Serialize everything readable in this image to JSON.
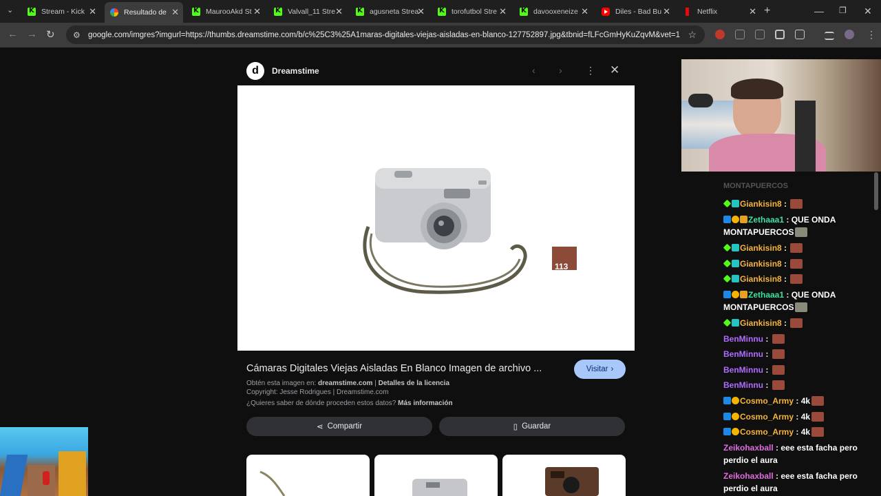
{
  "tabs": [
    {
      "title": "Stream - Kick",
      "favicon": "kick-icon",
      "active": false
    },
    {
      "title": "Resultado de",
      "favicon": "google-icon",
      "active": true
    },
    {
      "title": "MaurooAkd St",
      "favicon": "kick-icon",
      "active": false
    },
    {
      "title": "Valvall_11 Stre",
      "favicon": "kick-icon",
      "active": false
    },
    {
      "title": "agusneta Strea",
      "favicon": "kick-icon",
      "active": false
    },
    {
      "title": "torofutbol Stre",
      "favicon": "kick-icon",
      "active": false
    },
    {
      "title": "davooxeneize",
      "favicon": "kick-icon",
      "active": false
    },
    {
      "title": "Diles - Bad Bu",
      "favicon": "youtube-icon",
      "active": false
    },
    {
      "title": "Netflix",
      "favicon": "netflix-icon",
      "active": false
    }
  ],
  "toolbar": {
    "url": "google.com/imgres?imgurl=https://thumbs.dreamstime.com/b/c%25C3%25A1maras-digitales-viejas-aisladas-en-blanco-127752897.jpg&tbnid=fLFcGmHyKuZqvM&vet=1&i..."
  },
  "viewer": {
    "source_logo": "d",
    "source_name": "Dreamstime",
    "title": "Cámaras Digitales Viejas Aisladas En Blanco Imagen de archivo ...",
    "visit_label": "Visitar",
    "obtain_prefix": "Obtén esta imagen en:",
    "obtain_site": "dreamstime.com",
    "license_sep": "|",
    "license_label": "Detalles de la licencia",
    "copyright": "Copyright: Jesse Rodrigues | Dreamstime.com",
    "origin_question": "¿Quieres saber de dónde proceden estos datos?",
    "more_info": "Más información",
    "share_label": "Compartir",
    "save_label": "Guardar",
    "overlay_number": "113"
  },
  "chat": [
    {
      "user": "Giankisin8",
      "color": "orange",
      "badges": [
        "green",
        "teal"
      ],
      "text": "",
      "emote": true
    },
    {
      "user": "Zethaaa1",
      "color": "teal",
      "badges": [
        "blue",
        "gold",
        "orange"
      ],
      "text": "QUE ONDA MONTAPUERCOS",
      "emote": true
    },
    {
      "user": "Giankisin8",
      "color": "orange",
      "badges": [
        "green",
        "teal"
      ],
      "text": "",
      "emote": true
    },
    {
      "user": "Giankisin8",
      "color": "orange",
      "badges": [
        "green",
        "teal"
      ],
      "text": "",
      "emote": true
    },
    {
      "user": "Giankisin8",
      "color": "orange",
      "badges": [
        "green",
        "teal"
      ],
      "text": "",
      "emote": true
    },
    {
      "user": "Zethaaa1",
      "color": "teal",
      "badges": [
        "blue",
        "gold",
        "orange"
      ],
      "text": "QUE ONDA MONTAPUERCOS",
      "emote": true
    },
    {
      "user": "Giankisin8",
      "color": "orange",
      "badges": [
        "green",
        "teal"
      ],
      "text": "",
      "emote": true
    },
    {
      "user": "BenMinnu",
      "color": "purple",
      "badges": [],
      "text": "",
      "emote": true
    },
    {
      "user": "BenMinnu",
      "color": "purple",
      "badges": [],
      "text": "",
      "emote": true
    },
    {
      "user": "BenMinnu",
      "color": "purple",
      "badges": [],
      "text": "",
      "emote": true
    },
    {
      "user": "BenMinnu",
      "color": "purple",
      "badges": [],
      "text": "",
      "emote": true
    },
    {
      "user": "Cosmo_Army",
      "color": "orange",
      "badges": [
        "blue",
        "gold"
      ],
      "text": "4k",
      "emote": true
    },
    {
      "user": "Cosmo_Army",
      "color": "orange",
      "badges": [
        "blue",
        "gold"
      ],
      "text": "4k",
      "emote": true
    },
    {
      "user": "Cosmo_Army",
      "color": "orange",
      "badges": [
        "blue",
        "gold"
      ],
      "text": "4k",
      "emote": true
    },
    {
      "user": "Zeikohaxball",
      "color": "pink",
      "badges": [],
      "text": "eee esta facha pero perdio el aura",
      "emote": false
    },
    {
      "user": "Zeikohaxball",
      "color": "pink",
      "badges": [],
      "text": "eee esta facha pero perdio el aura",
      "emote": false
    }
  ],
  "chat_header_partial": "MONTAPUERCOS"
}
